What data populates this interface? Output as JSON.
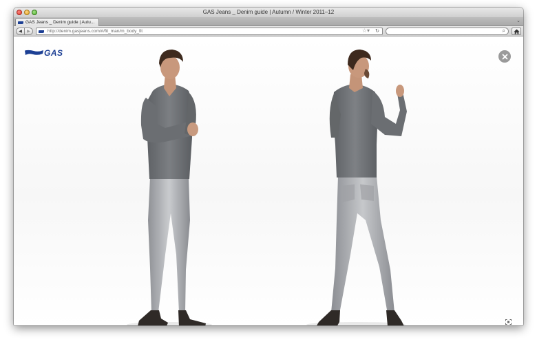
{
  "window": {
    "title": "GAS Jeans _ Denim guide | Autumn / Winter 2011–12"
  },
  "tabs": [
    {
      "label": "GAS Jeans _ Denim guide | Autu..."
    }
  ],
  "navbar": {
    "url": "http://denim.gasjeans.com/#/fit_man/m_body_fit",
    "search_value": ""
  },
  "content": {
    "logo_text": "GAS"
  },
  "icons": {
    "back": "back-arrow-icon",
    "forward": "forward-arrow-icon",
    "bookmark": "star-icon",
    "reload": "reload-icon",
    "search": "search-icon",
    "home": "home-icon",
    "close": "close-icon",
    "expand": "expand-icon"
  },
  "colors": {
    "brand": "#1c3f94",
    "close_button": "#9a9a9a"
  }
}
